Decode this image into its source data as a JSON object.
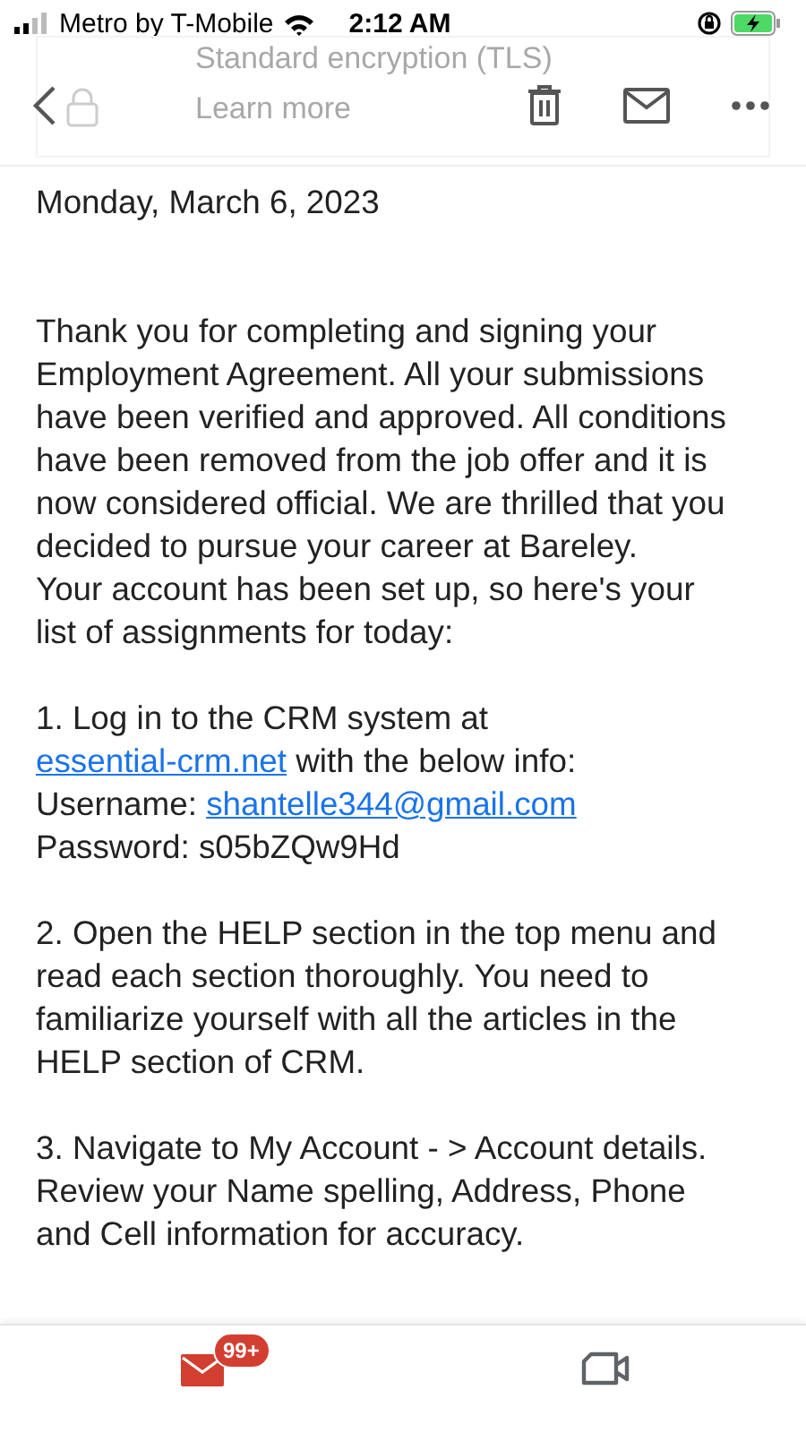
{
  "status_bar": {
    "carrier": "Metro by T-Mobile",
    "time": "2:12 AM"
  },
  "encryption_card": {
    "title": "Standard encryption (TLS)",
    "link": "Learn more"
  },
  "email": {
    "date": "Monday, March 6, 2023",
    "blocks": [
      {
        "lines": [
          {
            "parts": [
              {
                "text": "Thank you for completing and signing your Employment Agreement. All your submissions have been verified and approved. All conditions have been removed from the job offer and it is now considered official. We are thrilled that you decided to pursue your career at Bareley."
              }
            ]
          },
          {
            "parts": [
              {
                "text": "Your account has been set up, so here's your list of assignments for today:"
              }
            ]
          }
        ]
      },
      {
        "lines": [
          {
            "parts": [
              {
                "text": "1. Log in to the CRM system at "
              },
              {
                "link": "essential-crm.net"
              },
              {
                "text": " with the below info:"
              }
            ]
          },
          {
            "parts": [
              {
                "text": "Username: "
              },
              {
                "link": "shantelle344@gmail.com"
              }
            ]
          },
          {
            "parts": [
              {
                "text": "Password: s05bZQw9Hd"
              }
            ]
          }
        ]
      },
      {
        "lines": [
          {
            "parts": [
              {
                "text": "2. Open the HELP section in the top menu and read each section thoroughly. You need to familiarize yourself with all the articles in the HELP section of CRM."
              }
            ]
          }
        ]
      },
      {
        "lines": [
          {
            "parts": [
              {
                "text": "3. Navigate to My Account - > Account details. Review your Name spelling, Address, Phone and Cell information for accuracy."
              }
            ]
          }
        ]
      }
    ]
  },
  "bottom_tabs": [
    {
      "kind": "mail",
      "badge": "99+",
      "selected": true
    },
    {
      "kind": "video",
      "selected": false
    }
  ]
}
